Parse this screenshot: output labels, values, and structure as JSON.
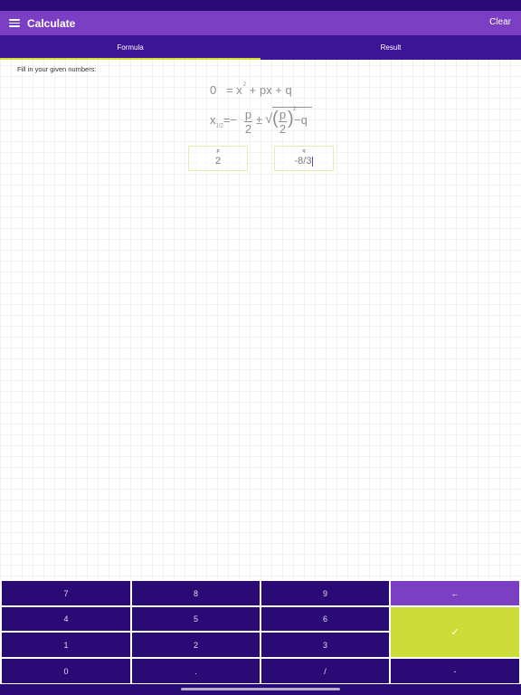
{
  "app_bar": {
    "title": "Calculate",
    "clear_label": "Clear",
    "menu_icon": "menu-icon"
  },
  "tabs": [
    {
      "label": "Formula",
      "active": true
    },
    {
      "label": "Result",
      "active": false
    }
  ],
  "instruction": "Fill in your given numbers:",
  "formula": {
    "line1": {
      "lhs": "0",
      "eq": "= x",
      "exp": "2",
      "rest": "+ px + q"
    },
    "line2": {
      "x": "x",
      "sub": "1/2",
      "eq": "=−",
      "p": "p",
      "two": "2",
      "pm": "±",
      "root": "√",
      "exp": "2",
      "minus_q": "−q"
    }
  },
  "fields": {
    "p": {
      "label": "p",
      "value": "2"
    },
    "q": {
      "label": "q",
      "value": "-8/3"
    }
  },
  "keypad": {
    "rows": [
      [
        "7",
        "8",
        "9"
      ],
      [
        "4",
        "5",
        "6"
      ],
      [
        "1",
        "2",
        "3"
      ],
      [
        "0",
        ".",
        "/"
      ]
    ],
    "back_icon": "←",
    "ok_icon": "✓",
    "minus": "-"
  },
  "colors": {
    "primary": "#7b3fc4",
    "dark": "#2a0a74",
    "tab_bg": "#3d1397",
    "accent": "#cddc39"
  }
}
